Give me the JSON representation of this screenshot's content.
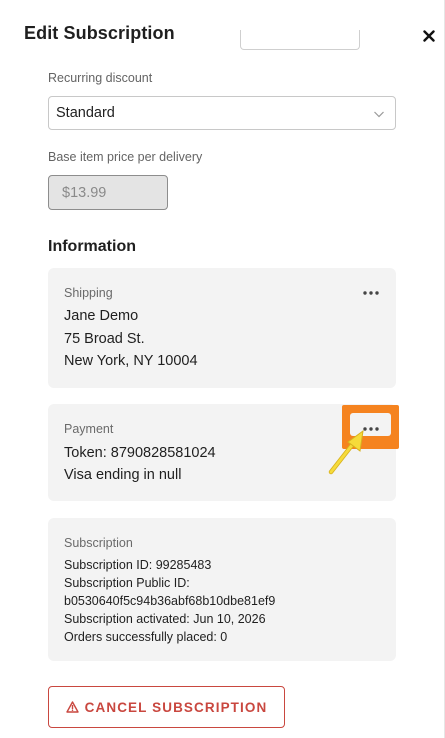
{
  "header": {
    "title": "Edit Subscription",
    "close_icon": "close-icon"
  },
  "form": {
    "recurring_discount_label": "Recurring discount",
    "recurring_discount_value": "Standard",
    "base_price_label": "Base item price per delivery",
    "base_price_placeholder": "$13.99"
  },
  "information": {
    "heading": "Information",
    "shipping": {
      "label": "Shipping",
      "lines": [
        "Jane Demo",
        "75 Broad St.",
        "New York, NY 10004"
      ]
    },
    "payment": {
      "label": "Payment",
      "lines": [
        "Token: 8790828581024",
        "Visa ending in null"
      ]
    },
    "subscription": {
      "label": "Subscription",
      "lines": [
        "Subscription ID: 99285483",
        "Subscription Public ID:",
        "b0530640f5c94b36abf68b10dbe81ef9",
        "Subscription activated: Jun 10, 2026",
        "Orders successfully placed: 0"
      ]
    }
  },
  "actions": {
    "cancel_label": "CANCEL SUBSCRIPTION"
  },
  "colors": {
    "danger": "#c9473f",
    "highlight": "#f5831f",
    "arrow": "#f2d22e",
    "card_bg": "#f3f3f3"
  }
}
